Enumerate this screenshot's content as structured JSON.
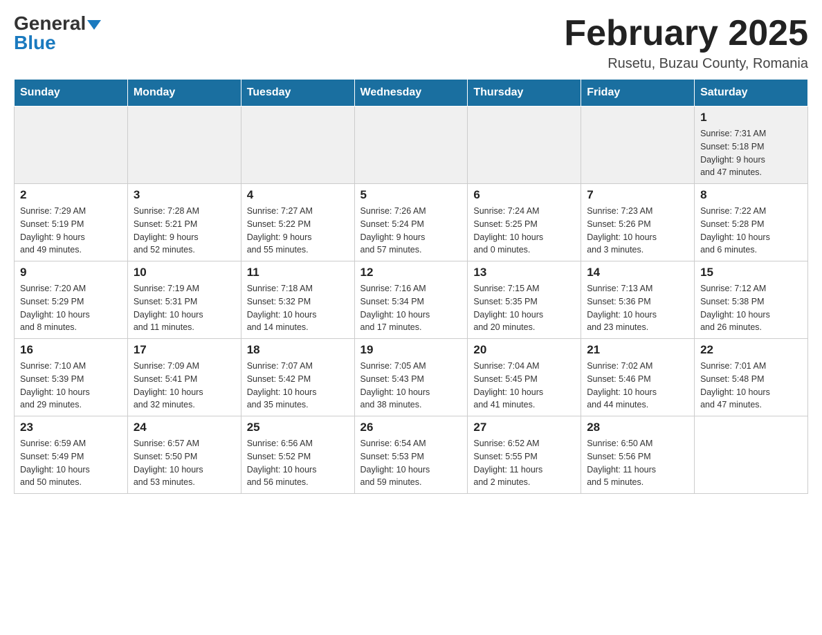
{
  "header": {
    "logo_general": "General",
    "logo_blue": "Blue",
    "month_title": "February 2025",
    "location": "Rusetu, Buzau County, Romania"
  },
  "weekdays": [
    "Sunday",
    "Monday",
    "Tuesday",
    "Wednesday",
    "Thursday",
    "Friday",
    "Saturday"
  ],
  "weeks": [
    [
      {
        "day": "",
        "info": ""
      },
      {
        "day": "",
        "info": ""
      },
      {
        "day": "",
        "info": ""
      },
      {
        "day": "",
        "info": ""
      },
      {
        "day": "",
        "info": ""
      },
      {
        "day": "",
        "info": ""
      },
      {
        "day": "1",
        "info": "Sunrise: 7:31 AM\nSunset: 5:18 PM\nDaylight: 9 hours\nand 47 minutes."
      }
    ],
    [
      {
        "day": "2",
        "info": "Sunrise: 7:29 AM\nSunset: 5:19 PM\nDaylight: 9 hours\nand 49 minutes."
      },
      {
        "day": "3",
        "info": "Sunrise: 7:28 AM\nSunset: 5:21 PM\nDaylight: 9 hours\nand 52 minutes."
      },
      {
        "day": "4",
        "info": "Sunrise: 7:27 AM\nSunset: 5:22 PM\nDaylight: 9 hours\nand 55 minutes."
      },
      {
        "day": "5",
        "info": "Sunrise: 7:26 AM\nSunset: 5:24 PM\nDaylight: 9 hours\nand 57 minutes."
      },
      {
        "day": "6",
        "info": "Sunrise: 7:24 AM\nSunset: 5:25 PM\nDaylight: 10 hours\nand 0 minutes."
      },
      {
        "day": "7",
        "info": "Sunrise: 7:23 AM\nSunset: 5:26 PM\nDaylight: 10 hours\nand 3 minutes."
      },
      {
        "day": "8",
        "info": "Sunrise: 7:22 AM\nSunset: 5:28 PM\nDaylight: 10 hours\nand 6 minutes."
      }
    ],
    [
      {
        "day": "9",
        "info": "Sunrise: 7:20 AM\nSunset: 5:29 PM\nDaylight: 10 hours\nand 8 minutes."
      },
      {
        "day": "10",
        "info": "Sunrise: 7:19 AM\nSunset: 5:31 PM\nDaylight: 10 hours\nand 11 minutes."
      },
      {
        "day": "11",
        "info": "Sunrise: 7:18 AM\nSunset: 5:32 PM\nDaylight: 10 hours\nand 14 minutes."
      },
      {
        "day": "12",
        "info": "Sunrise: 7:16 AM\nSunset: 5:34 PM\nDaylight: 10 hours\nand 17 minutes."
      },
      {
        "day": "13",
        "info": "Sunrise: 7:15 AM\nSunset: 5:35 PM\nDaylight: 10 hours\nand 20 minutes."
      },
      {
        "day": "14",
        "info": "Sunrise: 7:13 AM\nSunset: 5:36 PM\nDaylight: 10 hours\nand 23 minutes."
      },
      {
        "day": "15",
        "info": "Sunrise: 7:12 AM\nSunset: 5:38 PM\nDaylight: 10 hours\nand 26 minutes."
      }
    ],
    [
      {
        "day": "16",
        "info": "Sunrise: 7:10 AM\nSunset: 5:39 PM\nDaylight: 10 hours\nand 29 minutes."
      },
      {
        "day": "17",
        "info": "Sunrise: 7:09 AM\nSunset: 5:41 PM\nDaylight: 10 hours\nand 32 minutes."
      },
      {
        "day": "18",
        "info": "Sunrise: 7:07 AM\nSunset: 5:42 PM\nDaylight: 10 hours\nand 35 minutes."
      },
      {
        "day": "19",
        "info": "Sunrise: 7:05 AM\nSunset: 5:43 PM\nDaylight: 10 hours\nand 38 minutes."
      },
      {
        "day": "20",
        "info": "Sunrise: 7:04 AM\nSunset: 5:45 PM\nDaylight: 10 hours\nand 41 minutes."
      },
      {
        "day": "21",
        "info": "Sunrise: 7:02 AM\nSunset: 5:46 PM\nDaylight: 10 hours\nand 44 minutes."
      },
      {
        "day": "22",
        "info": "Sunrise: 7:01 AM\nSunset: 5:48 PM\nDaylight: 10 hours\nand 47 minutes."
      }
    ],
    [
      {
        "day": "23",
        "info": "Sunrise: 6:59 AM\nSunset: 5:49 PM\nDaylight: 10 hours\nand 50 minutes."
      },
      {
        "day": "24",
        "info": "Sunrise: 6:57 AM\nSunset: 5:50 PM\nDaylight: 10 hours\nand 53 minutes."
      },
      {
        "day": "25",
        "info": "Sunrise: 6:56 AM\nSunset: 5:52 PM\nDaylight: 10 hours\nand 56 minutes."
      },
      {
        "day": "26",
        "info": "Sunrise: 6:54 AM\nSunset: 5:53 PM\nDaylight: 10 hours\nand 59 minutes."
      },
      {
        "day": "27",
        "info": "Sunrise: 6:52 AM\nSunset: 5:55 PM\nDaylight: 11 hours\nand 2 minutes."
      },
      {
        "day": "28",
        "info": "Sunrise: 6:50 AM\nSunset: 5:56 PM\nDaylight: 11 hours\nand 5 minutes."
      },
      {
        "day": "",
        "info": ""
      }
    ]
  ]
}
